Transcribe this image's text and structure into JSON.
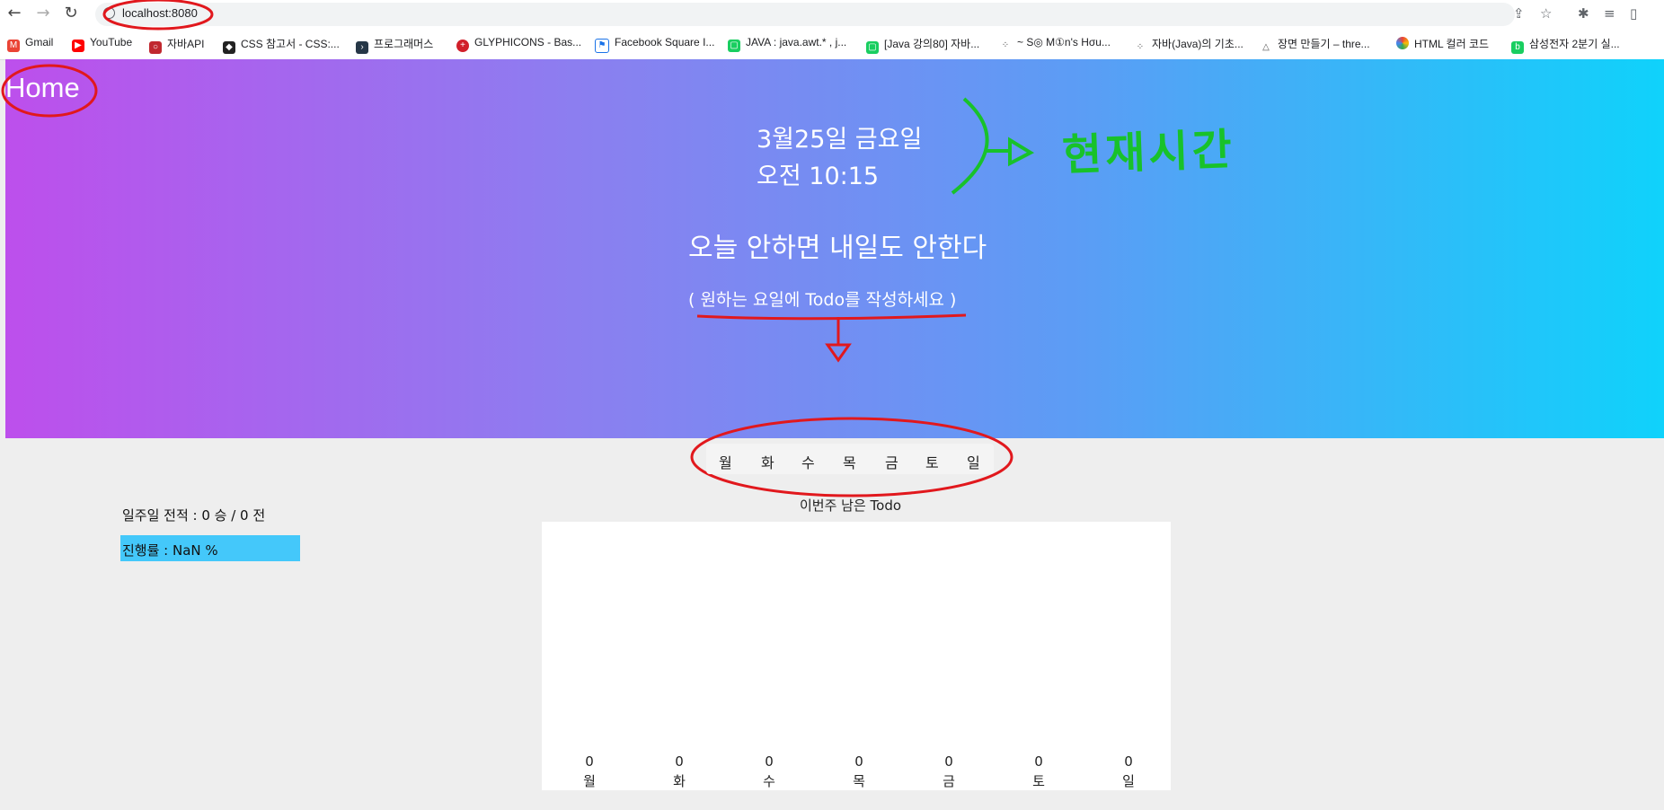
{
  "browser": {
    "url": "localhost:8080",
    "bookmarks": [
      "Gmail",
      "YouTube",
      "자바API",
      "CSS 참고서 - CSS:...",
      "프로그래머스",
      "GLYPHICONS - Bas...",
      "Facebook Square I...",
      "JAVA : java.awt.* , j...",
      "[Java 강의80] 자바...",
      "~ S◎ M①n's Hσu...",
      "자바(Java)의 기초...",
      "장면 만들기 – thre...",
      "HTML 컬러 코드",
      "삼성전자 2분기 실..."
    ]
  },
  "header": {
    "home": "Home",
    "date": "3월25일 금요일",
    "time": "오전 10:15",
    "motto": "오늘 안하면 내일도 안한다",
    "hint": "( 원하는 요일에 Todo를 작성하세요 )",
    "annotation": "현재시간"
  },
  "days": [
    "월",
    "화",
    "수",
    "목",
    "금",
    "토",
    "일"
  ],
  "stats": {
    "record": "일주일 전적 : 0 승 / 0 전",
    "progress": "진행률 : NaN %"
  },
  "chart_data": {
    "type": "bar",
    "title": "이번주 남은 Todo",
    "categories": [
      "월",
      "화",
      "수",
      "목",
      "금",
      "토",
      "일"
    ],
    "values": [
      0,
      0,
      0,
      0,
      0,
      0,
      0
    ]
  },
  "colors": {
    "progress_bg": "#44c8fa",
    "annotation_red": "#e1181d",
    "annotation_green": "#18c22a"
  }
}
